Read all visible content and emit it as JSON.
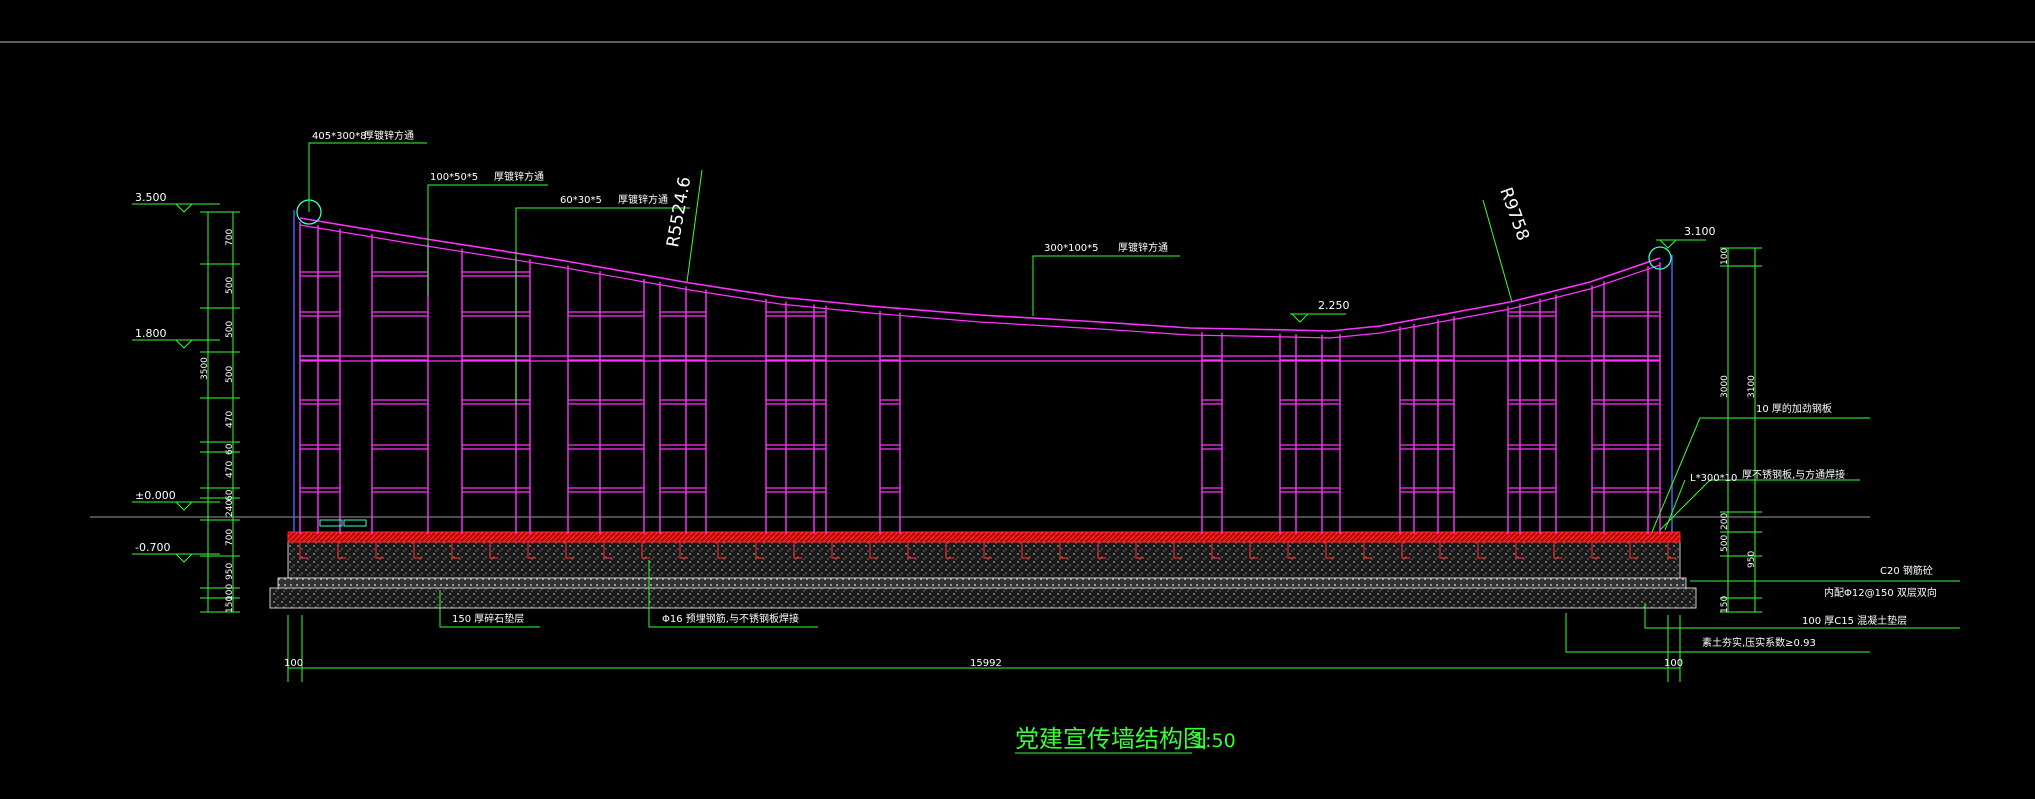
{
  "title": {
    "text": "党建宣传墙结构图",
    "scale": "1:50"
  },
  "labels": {
    "tube_top": "405*300*8",
    "tube_top_desc": "厚镀锌方通",
    "tube_100": "100*50*5",
    "tube_100_desc": "厚镀锌方通",
    "tube_60": "60*30*5",
    "tube_60_desc": "厚镀锌方通",
    "tube_300": "300*100*5",
    "tube_300_desc": "厚镀锌方通",
    "radius_left": "R5524.6",
    "radius_right": "R9758",
    "elev_mid": "2.250",
    "elev_right_top": "3.100",
    "steel_plate": "10  厚的加劲钢板",
    "stainless_code": "L*300*10",
    "stainless_desc": "厚不锈钢板,与方通焊接",
    "concrete": "C20  钢筋砼",
    "rebar": "内配Φ12@150  双层双向",
    "cushion": "100  厚C15  混凝土垫层",
    "soil": "素土夯实,压实系数≥0.93",
    "gravel": "150  厚碎石垫层",
    "anchor": "Φ16  预埋钢筋,与不锈钢板焊接",
    "total_width": "15992",
    "edge_left": "100",
    "edge_right": "100"
  },
  "left_dims": {
    "elevations": [
      "3.500",
      "1.800",
      "±0.000",
      "-0.700"
    ],
    "total": "3500",
    "segments": [
      "700",
      "500",
      "500",
      "500",
      "470",
      "60",
      "470",
      "60",
      "240",
      "700",
      "950",
      "100",
      "150"
    ]
  },
  "right_dims": {
    "segments": [
      "100",
      "3000",
      "3100",
      "200",
      "500",
      "950",
      "150"
    ]
  },
  "colors": {
    "frame": "#ff33ff",
    "dims": "#33ff33",
    "text": "#ffffff",
    "edge": "#4d6cff",
    "slab_top": "#ff2a2a",
    "title": "#33ff33",
    "ground": "#9a9a9a"
  }
}
